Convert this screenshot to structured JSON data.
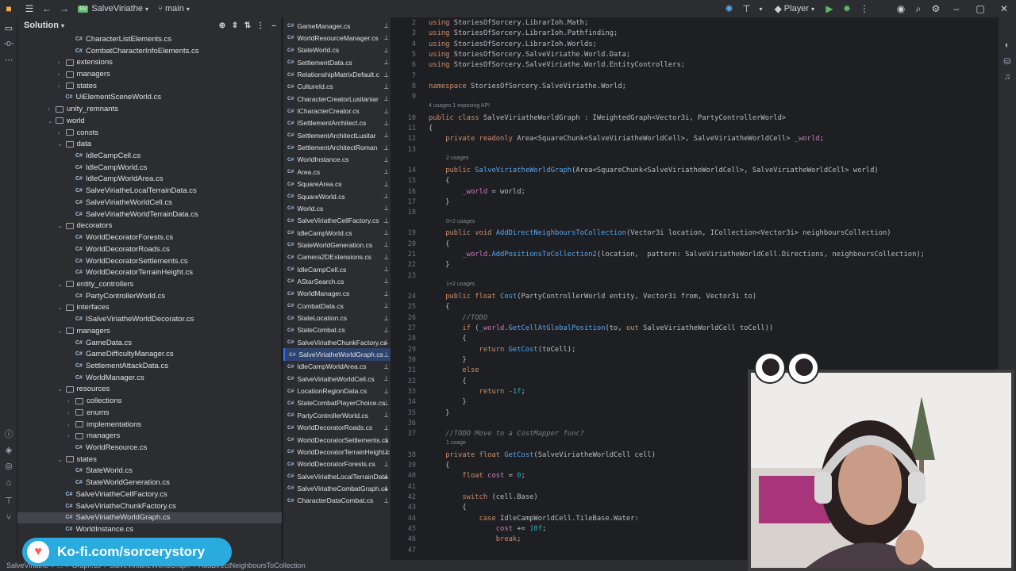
{
  "topbar": {
    "project": "SalveViriathe",
    "project_badge": "SV",
    "branch": "main",
    "run_config": "Player"
  },
  "solution": {
    "title": "Solution"
  },
  "tree": [
    {
      "label": "CharacterListElements.cs",
      "type": "cs",
      "indent": 6
    },
    {
      "label": "CombatCharacterInfoElements.cs",
      "type": "cs",
      "indent": 6
    },
    {
      "label": "extensions",
      "type": "folder",
      "indent": 5,
      "open": false
    },
    {
      "label": "managers",
      "type": "folder",
      "indent": 5,
      "open": false
    },
    {
      "label": "states",
      "type": "folder",
      "indent": 5,
      "open": false
    },
    {
      "label": "UiElementSceneWorld.cs",
      "type": "cs",
      "indent": 5
    },
    {
      "label": "unity_remnants",
      "type": "folder",
      "indent": 4,
      "open": false
    },
    {
      "label": "world",
      "type": "folder",
      "indent": 4,
      "open": true
    },
    {
      "label": "consts",
      "type": "folder",
      "indent": 5,
      "open": false
    },
    {
      "label": "data",
      "type": "folder",
      "indent": 5,
      "open": true
    },
    {
      "label": "IdleCampCell.cs",
      "type": "cs",
      "indent": 6
    },
    {
      "label": "IdleCampWorld.cs",
      "type": "cs",
      "indent": 6
    },
    {
      "label": "IdleCampWorldArea.cs",
      "type": "cs",
      "indent": 6
    },
    {
      "label": "SalveViriatheLocalTerrainData.cs",
      "type": "cs",
      "indent": 6
    },
    {
      "label": "SalveViriatheWorldCell.cs",
      "type": "cs",
      "indent": 6
    },
    {
      "label": "SalveViriatheWorldTerrainData.cs",
      "type": "cs",
      "indent": 6
    },
    {
      "label": "decorators",
      "type": "folder",
      "indent": 5,
      "open": true
    },
    {
      "label": "WorldDecoratorForests.cs",
      "type": "cs",
      "indent": 6
    },
    {
      "label": "WorldDecoratorRoads.cs",
      "type": "cs",
      "indent": 6
    },
    {
      "label": "WorldDecoratorSettlements.cs",
      "type": "cs",
      "indent": 6
    },
    {
      "label": "WorldDecoratorTerrainHeight.cs",
      "type": "cs",
      "indent": 6
    },
    {
      "label": "entity_controllers",
      "type": "folder",
      "indent": 5,
      "open": true
    },
    {
      "label": "PartyControllerWorld.cs",
      "type": "cs",
      "indent": 6
    },
    {
      "label": "interfaces",
      "type": "folder",
      "indent": 5,
      "open": true
    },
    {
      "label": "ISalveViriatheWorldDecorator.cs",
      "type": "cs",
      "indent": 6
    },
    {
      "label": "managers",
      "type": "folder",
      "indent": 5,
      "open": true
    },
    {
      "label": "GameData.cs",
      "type": "cs",
      "indent": 6
    },
    {
      "label": "GameDifficultyManager.cs",
      "type": "cs",
      "indent": 6
    },
    {
      "label": "SettlementAttackData.cs",
      "type": "cs",
      "indent": 6
    },
    {
      "label": "WorldManager.cs",
      "type": "cs",
      "indent": 6
    },
    {
      "label": "resources",
      "type": "folder",
      "indent": 5,
      "open": true
    },
    {
      "label": "collections",
      "type": "folder",
      "indent": 6,
      "open": false
    },
    {
      "label": "enums",
      "type": "folder",
      "indent": 6,
      "open": false
    },
    {
      "label": "implementations",
      "type": "folder",
      "indent": 6,
      "open": false
    },
    {
      "label": "managers",
      "type": "folder",
      "indent": 6,
      "open": false
    },
    {
      "label": "WorldResource.cs",
      "type": "cs",
      "indent": 6
    },
    {
      "label": "states",
      "type": "folder",
      "indent": 5,
      "open": true
    },
    {
      "label": "StateWorld.cs",
      "type": "cs",
      "indent": 6
    },
    {
      "label": "StateWorldGeneration.cs",
      "type": "cs",
      "indent": 6
    },
    {
      "label": "SalveViriatheCellFactory.cs",
      "type": "cs",
      "indent": 5
    },
    {
      "label": "SalveViriatheChunkFactory.cs",
      "type": "cs",
      "indent": 5
    },
    {
      "label": "SalveViriatheWorldGraph.cs",
      "type": "cs",
      "indent": 5,
      "selected": true
    },
    {
      "label": "WorldInstance.cs",
      "type": "cs",
      "indent": 5
    }
  ],
  "tabs": [
    "GameManager.cs",
    "WorldResourceManager.cs",
    "StateWorld.cs",
    "SettlementData.cs",
    "RelationshipMatrixDefault.c",
    "CultureId.cs",
    "CharacterCreatorLusitaniar",
    "ICharacterCreator.cs",
    "ISettlementArchitect.cs",
    "SettlementArchitectLusitar",
    "SettlementArchitectRoman",
    "WorldInstance.cs",
    "Area.cs",
    "SquareArea.cs",
    "SquareWorld.cs",
    "World.cs",
    "SalveViriatheCellFactory.cs",
    "IdleCampWorld.cs",
    "StateWorldGeneration.cs",
    "Camera2DExtensions.cs",
    "IdleCampCell.cs",
    "AStarSearch.cs",
    "WorldManager.cs",
    "CombatData.cs",
    "StateLocation.cs",
    "StateCombat.cs",
    "SalveViriatheChunkFactory.cs",
    "SalveViriatheWorldGraph.cs",
    "IdleCampWorldArea.cs",
    "SalveViriatheWorldCell.cs",
    "LocationRegionData.cs",
    "StateCombatPlayerChoice.cs",
    "PartyControllerWorld.cs",
    "WorldDecoratorRoads.cs",
    "WorldDecoratorSettlements.cs",
    "WorldDecoratorTerrainHeight.c",
    "WorldDecoratorForests.cs",
    "SalveViriatheLocalTerrainData",
    "SalveViriatheCombatGraph.cs",
    "CharacterDataCombat.cs"
  ],
  "active_tab": "SalveViriatheWorldGraph.cs",
  "code": [
    {
      "n": "2",
      "t": "using StoriesOfSorcery.LibrarIoh.Math;"
    },
    {
      "n": "3",
      "t": "using StoriesOfSorcery.LibrarIoh.Pathfinding;"
    },
    {
      "n": "4",
      "t": "using StoriesOfSorcery.LibrarIoh.Worlds;"
    },
    {
      "n": "5",
      "t": "using StoriesOfSorcery.SalveViriathe.World.Data;"
    },
    {
      "n": "6",
      "t": "using StoriesOfSorcery.SalveViriathe.World.EntityControllers;"
    },
    {
      "n": "7",
      "t": ""
    },
    {
      "n": "8",
      "t": "namespace StoriesOfSorcery.SalveViriathe.World;"
    },
    {
      "n": "9",
      "t": ""
    },
    {
      "h": "4 usages   1 exposing API"
    },
    {
      "n": "10",
      "t": "public class SalveViriatheWorldGraph : IWeightedGraph<Vector3i, PartyControllerWorld>"
    },
    {
      "n": "11",
      "t": "{"
    },
    {
      "n": "12",
      "t": "    private readonly Area<SquareChunk<SalveViriatheWorldCell>, SalveViriatheWorldCell> _world;"
    },
    {
      "n": "13",
      "t": ""
    },
    {
      "h": "2 usages"
    },
    {
      "n": "14",
      "t": "    public SalveViriatheWorldGraph(Area<SquareChunk<SalveViriatheWorldCell>, SalveViriatheWorldCell> world)"
    },
    {
      "n": "15",
      "t": "    {"
    },
    {
      "n": "16",
      "t": "        _world = world;"
    },
    {
      "n": "17",
      "t": "    }"
    },
    {
      "n": "18",
      "t": ""
    },
    {
      "h": "0+2 usages"
    },
    {
      "n": "19",
      "t": "    public void AddDirectNeighboursToCollection(Vector3i location, ICollection<Vector3i> neighboursCollection)"
    },
    {
      "n": "20",
      "t": "    {"
    },
    {
      "n": "21",
      "t": "        _world.AddPositionsToCollection2(location,  pattern: SalveViriatheWorldCell.Directions, neighboursCollection);"
    },
    {
      "n": "22",
      "t": "    }"
    },
    {
      "n": "23",
      "t": ""
    },
    {
      "h": "1+2 usages"
    },
    {
      "n": "24",
      "t": "    public float Cost(PartyControllerWorld entity, Vector3i from, Vector3i to)"
    },
    {
      "n": "25",
      "t": "    {"
    },
    {
      "n": "26",
      "t": "        //TODO"
    },
    {
      "n": "27",
      "t": "        if (_world.GetCellAtGlobalPosition(to, out SalveViriatheWorldCell toCell))"
    },
    {
      "n": "28",
      "t": "        {"
    },
    {
      "n": "29",
      "t": "            return GetCost(toCell);"
    },
    {
      "n": "30",
      "t": "        }"
    },
    {
      "n": "31",
      "t": "        else"
    },
    {
      "n": "32",
      "t": "        {"
    },
    {
      "n": "33",
      "t": "            return -1f;"
    },
    {
      "n": "34",
      "t": "        }"
    },
    {
      "n": "35",
      "t": "    }"
    },
    {
      "n": "36",
      "t": ""
    },
    {
      "n": "37",
      "t": "    //TODO Move to a CostMapper func?"
    },
    {
      "h": "1 usage"
    },
    {
      "n": "38",
      "t": "    private float GetCost(SalveViriatheWorldCell cell)"
    },
    {
      "n": "39",
      "t": "    {"
    },
    {
      "n": "40",
      "t": "        float cost = 0;"
    },
    {
      "n": "41",
      "t": ""
    },
    {
      "n": "42",
      "t": "        switch (cell.Base)"
    },
    {
      "n": "43",
      "t": "        {"
    },
    {
      "n": "44",
      "t": "            case IdleCampWorldCell.TileBase.Water:"
    },
    {
      "n": "45",
      "t": "                cost += 10f;"
    },
    {
      "n": "46",
      "t": "                break;"
    },
    {
      "n": "47",
      "t": ""
    }
  ],
  "statusbar": {
    "crumbs": [
      "SalveViriathe",
      "...",
      "Graph.cs",
      "SalveViriatheWorldGraph",
      "AddDirectNeighboursToCollection"
    ]
  },
  "kofi": {
    "text": "Ko-fi.com/sorcerystory"
  },
  "colors": {
    "accent": "#3574f0",
    "kofi": "#29abe0"
  }
}
